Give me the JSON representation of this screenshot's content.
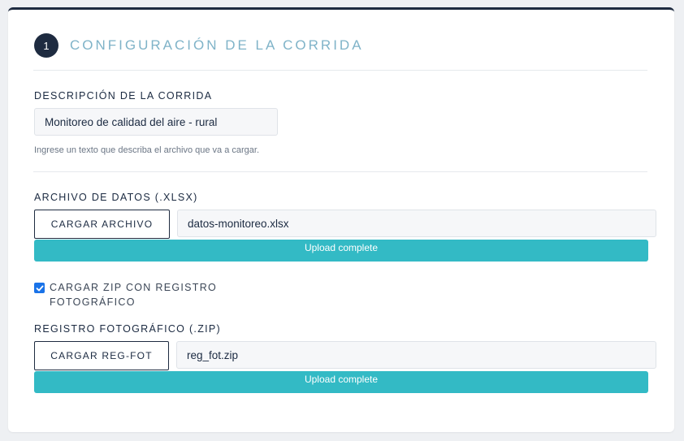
{
  "section": {
    "step_number": "1",
    "title": "CONFIGURACIÓN DE LA CORRIDA"
  },
  "description": {
    "label": "DESCRIPCIÓN DE LA CORRIDA",
    "value": "Monitoreo de calidad del aire - rural",
    "help": "Ingrese un texto que describa el archivo que va a cargar."
  },
  "data_file": {
    "label": "ARCHIVO DE DATOS (.XLSX)",
    "button_label": "CARGAR ARCHIVO",
    "filename": "datos-monitoreo.xlsx",
    "progress_text": "Upload complete",
    "progress_percent": 100
  },
  "zip_option": {
    "checked": true,
    "label": "CARGAR ZIP CON REGISTRO FOTOGRÁFICO"
  },
  "photo_file": {
    "label": "REGISTRO FOTOGRÁFICO (.ZIP)",
    "button_label": "CARGAR REG-FOT",
    "filename": "reg_fot.zip",
    "progress_text": "Upload complete",
    "progress_percent": 100
  },
  "colors": {
    "accent_title": "#7fb3c8",
    "progress": "#33bac5",
    "navy": "#1e2b40",
    "checkbox": "#1a73e8"
  },
  "icons": {
    "checkbox": "check-icon"
  }
}
